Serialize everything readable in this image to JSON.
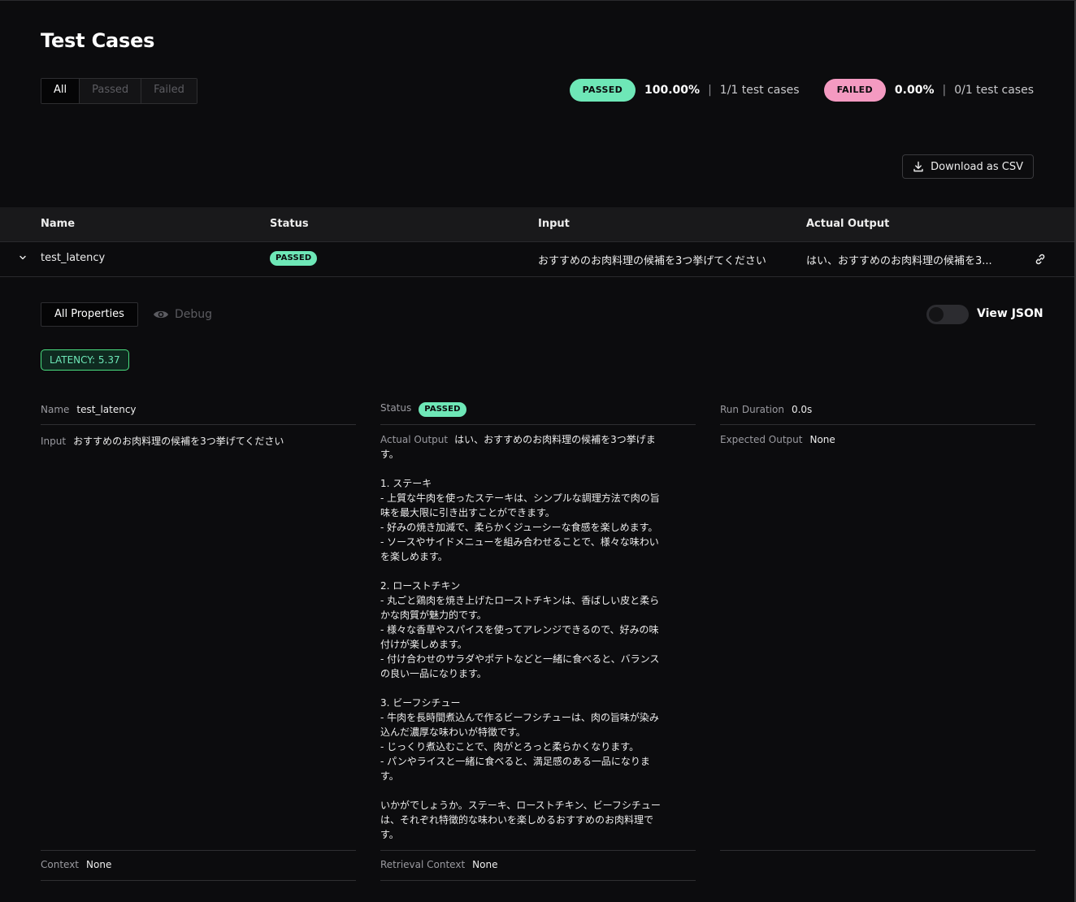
{
  "page": {
    "title": "Test Cases"
  },
  "filters": [
    "All",
    "Passed",
    "Failed"
  ],
  "summary": {
    "passed": {
      "label": "PASSED",
      "percent": "100.00%",
      "count": "1/1 test cases"
    },
    "failed": {
      "label": "FAILED",
      "percent": "0.00%",
      "count": "0/1 test cases"
    },
    "separator": "|"
  },
  "toolbar": {
    "download_label": "Download as CSV"
  },
  "table": {
    "columns": [
      "Name",
      "Status",
      "Input",
      "Actual Output"
    ],
    "rows": [
      {
        "name": "test_latency",
        "status": "PASSED",
        "input": "おすすめのお肉料理の候補を3つ挙げてください",
        "actual_output": "はい、おすすめのお肉料理の候補を3..."
      }
    ]
  },
  "details": {
    "tabs": {
      "all_properties": "All Properties",
      "debug": "Debug"
    },
    "view_json": "View JSON",
    "metric": "LATENCY: 5.37",
    "name": {
      "label": "Name",
      "value": "test_latency"
    },
    "status": {
      "label": "Status",
      "value": "PASSED"
    },
    "run_duration": {
      "label": "Run Duration",
      "value": "0.0s"
    },
    "input": {
      "label": "Input",
      "value": "おすすめのお肉料理の候補を3つ挙げてください"
    },
    "actual_output": {
      "label": "Actual Output",
      "value": "はい、おすすめのお肉料理の候補を3つ挙げます。\n\n1. ステーキ\n- 上質な牛肉を使ったステーキは、シンプルな調理方法で肉の旨味を最大限に引き出すことができます。\n- 好みの焼き加減で、柔らかくジューシーな食感を楽しめます。\n- ソースやサイドメニューを組み合わせることで、様々な味わいを楽しめます。\n\n2. ローストチキン\n- 丸ごと鶏肉を焼き上げたローストチキンは、香ばしい皮と柔らかな肉質が魅力的です。\n- 様々な香草やスパイスを使ってアレンジできるので、好みの味付けが楽しめます。\n- 付け合わせのサラダやポテトなどと一緒に食べると、バランスの良い一品になります。\n\n3. ビーフシチュー\n- 牛肉を長時間煮込んで作るビーフシチューは、肉の旨味が染み込んだ濃厚な味わいが特徴です。\n- じっくり煮込むことで、肉がとろっと柔らかくなります。\n- パンやライスと一緒に食べると、満足感のある一品になります。\n\nいかがでしょうか。ステーキ、ローストチキン、ビーフシチューは、それぞれ特徴的な味わいを楽しめるおすすめのお肉料理です。"
    },
    "expected_output": {
      "label": "Expected Output",
      "value": "None"
    },
    "context": {
      "label": "Context",
      "value": "None"
    },
    "retrieval_context": {
      "label": "Retrieval Context",
      "value": "None"
    }
  },
  "icons": {
    "download": "download-icon",
    "chevron": "chevron-down-icon",
    "link": "link-icon",
    "eye": "eye-icon"
  },
  "colors": {
    "passed": "#6ee7b7",
    "failed": "#f49ac1",
    "background": "#0c0c0e"
  }
}
